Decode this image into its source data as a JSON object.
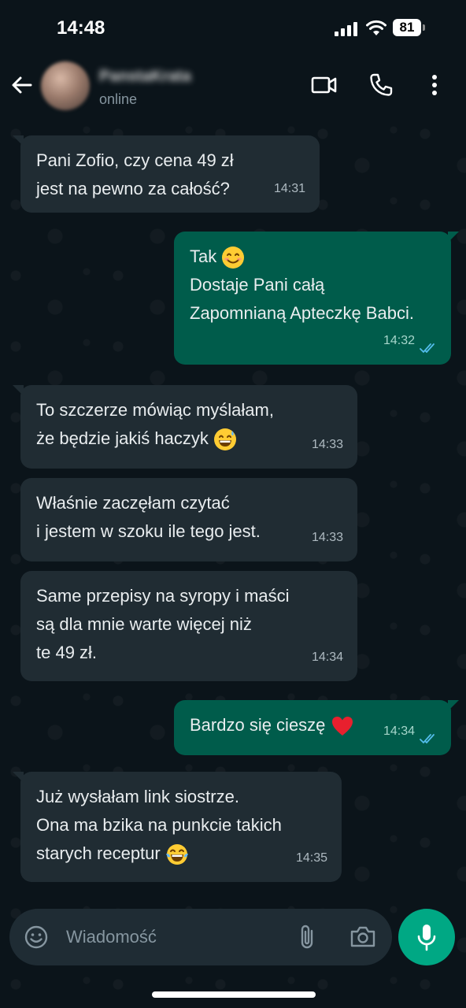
{
  "status_bar": {
    "time": "14:48",
    "battery": "81"
  },
  "header": {
    "contact_name": "PanstaKrata",
    "contact_status": "online"
  },
  "messages": [
    {
      "direction": "in",
      "text": "Pani Zofio, czy cena 49 zł\njest na pewno za całość?",
      "time": "14:31"
    },
    {
      "direction": "out",
      "text": "Tak",
      "emoji": "smiling-face-emoji",
      "text2": "Dostaje Pani całą\nZapomnianą Apteczkę Babci.",
      "time": "14:32",
      "read": true
    },
    {
      "direction": "in",
      "text": "To szczerze mówiąc myślałam,\nże będzie jakiś haczyk",
      "emoji": "grinning-sweat-emoji",
      "time": "14:33"
    },
    {
      "direction": "in",
      "text": "Właśnie zaczęłam czytać\ni jestem w szoku ile tego jest.",
      "time": "14:33"
    },
    {
      "direction": "in",
      "text": "Same przepisy na syropy i maści\nsą dla mnie warte więcej niż\nte 49 zł.",
      "time": "14:34"
    },
    {
      "direction": "out",
      "text": "Bardzo się cieszę",
      "emoji": "red-heart-emoji",
      "time": "14:34",
      "read": true
    },
    {
      "direction": "in",
      "text": "Już wysłałam link siostrze.\nOna ma bzika na punkcie takich\nstarych receptur",
      "emoji": "tears-of-joy-emoji",
      "time": "14:35"
    }
  ],
  "input": {
    "placeholder": "Wiadomość"
  },
  "colors": {
    "background": "#0b141a",
    "incoming_bubble": "#202c33",
    "outgoing_bubble": "#005c4b",
    "accent": "#00a884",
    "read_ticks": "#53bdeb"
  }
}
